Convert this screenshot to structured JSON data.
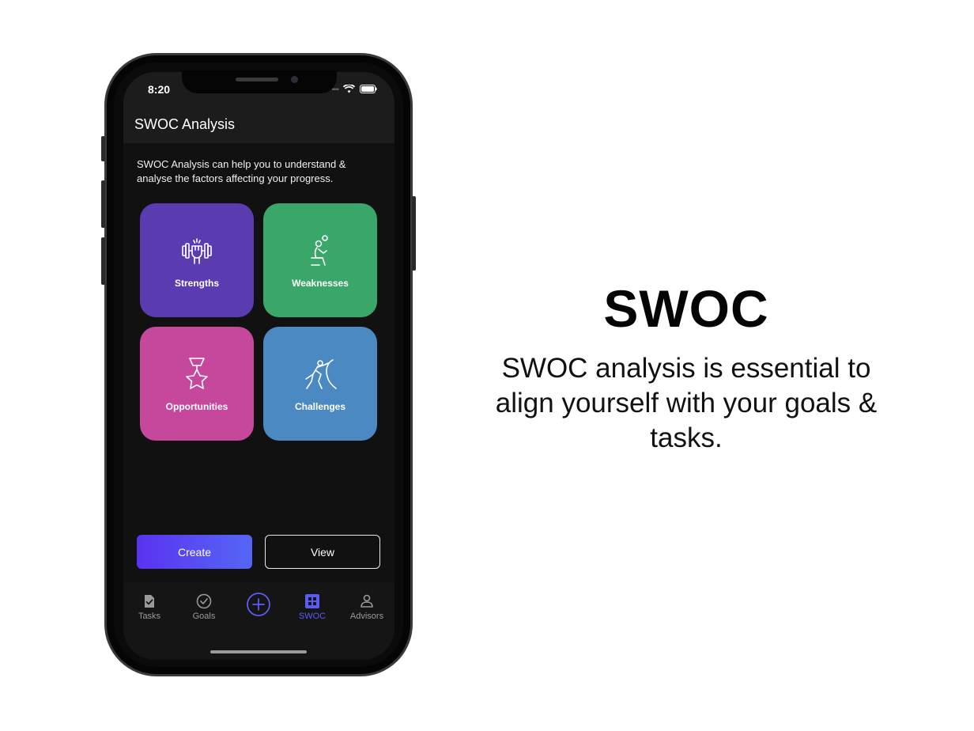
{
  "status_bar": {
    "time": "8:20"
  },
  "app": {
    "title": "SWOC Analysis"
  },
  "intro_text": "SWOC Analysis can help you to understand & analyse the factors affecting your progress.",
  "tiles": [
    {
      "label": "Strengths",
      "color": "#5b3cb0",
      "icon": "weightlifting-icon"
    },
    {
      "label": "Weaknesses",
      "color": "#38a769",
      "icon": "tired-person-icon"
    },
    {
      "label": "Opportunities",
      "color": "#c6489c",
      "icon": "star-medal-icon"
    },
    {
      "label": "Challenges",
      "color": "#4a89c2",
      "icon": "pushing-boulder-icon"
    }
  ],
  "buttons": {
    "create": "Create",
    "view": "View"
  },
  "tabbar": [
    {
      "label": "Tasks",
      "icon": "clipboard-check-icon",
      "active": false
    },
    {
      "label": "Goals",
      "icon": "check-circle-icon",
      "active": false
    },
    {
      "label": "",
      "icon": "plus-circle-icon",
      "active": false
    },
    {
      "label": "SWOC",
      "icon": "swoc-grid-icon",
      "active": true
    },
    {
      "label": "Advisors",
      "icon": "person-icon",
      "active": false
    }
  ],
  "hero": {
    "title": "SWOC",
    "description": "SWOC analysis is essential to align yourself with your goals & tasks."
  },
  "colors": {
    "accent": "#5a5cf5",
    "screen_bg": "#111111"
  }
}
